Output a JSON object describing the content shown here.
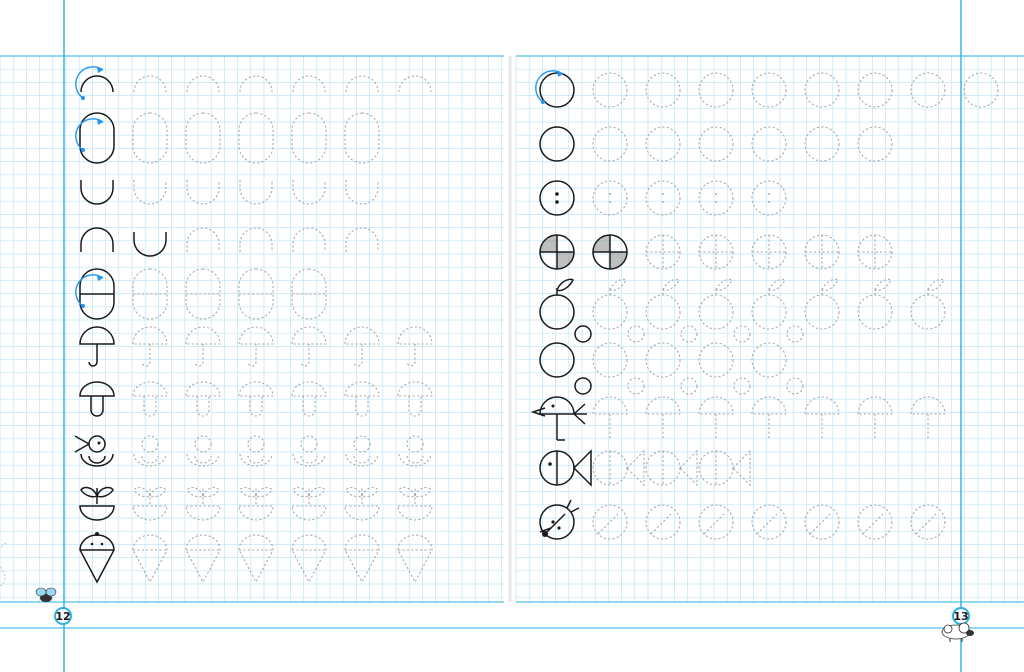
{
  "book": {
    "left_page_number": "12",
    "right_page_number": "13"
  },
  "colors": {
    "grid_minor": "#bfe6f5",
    "margin_line": "#2bb0e6",
    "ink": "#1a1a1a",
    "trace": "#aaaaaa",
    "accent_arrow": "#2196f3",
    "hatch": "#8a8a8a"
  },
  "left_page": {
    "rows": [
      {
        "shape": "arc-top",
        "guide": "arrow-ccw",
        "traces": 6
      },
      {
        "shape": "oval-outline",
        "guide": "arrow-ccw",
        "traces": 5
      },
      {
        "shape": "cup",
        "traces": 5
      },
      {
        "shape": "arch",
        "extra_solid": "cup",
        "traces": 4
      },
      {
        "shape": "circle-halves",
        "guide": "arrows",
        "traces": 4
      },
      {
        "shape": "umbrella",
        "traces": 6
      },
      {
        "shape": "mushroom",
        "traces": 6
      },
      {
        "shape": "chick",
        "traces": 6
      },
      {
        "shape": "flower-pot",
        "traces": 6
      },
      {
        "shape": "ice-cream",
        "traces": 6
      }
    ]
  },
  "right_page": {
    "rows": [
      {
        "shape": "circle",
        "guide": "arrow-ccw",
        "traces": 8
      },
      {
        "shape": "circle",
        "traces": 6
      },
      {
        "shape": "button",
        "traces": 4
      },
      {
        "shape": "ball-quarters",
        "extra_solid": "ball-quarters",
        "traces": 5
      },
      {
        "shape": "apple",
        "traces": 7
      },
      {
        "shape": "bubbles",
        "traces": 4
      },
      {
        "shape": "bird",
        "traces": 7
      },
      {
        "shape": "fish",
        "traces": 3
      },
      {
        "shape": "ladybug",
        "traces": 7
      }
    ]
  },
  "decor": {
    "left_corner": "bee-icon",
    "right_corner": "sheep-icon"
  }
}
